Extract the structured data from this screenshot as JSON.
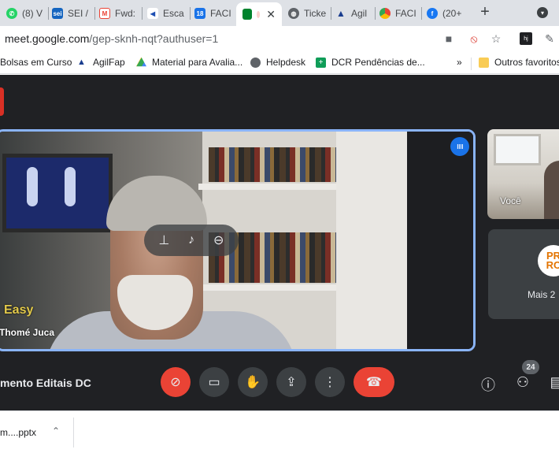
{
  "browser": {
    "tabs": [
      {
        "label": "(8) V",
        "icon": "whatsapp-icon",
        "color": "#25d366"
      },
      {
        "label": "SEI /",
        "icon": "sei-icon",
        "color": "#1565c0"
      },
      {
        "label": "Fwd:",
        "icon": "gmail-icon",
        "color": "#ea4335"
      },
      {
        "label": "Esca",
        "icon": "carrefour-icon",
        "color": "#1e4fb3"
      },
      {
        "label": "FACI",
        "icon": "calendar-icon",
        "color": "#1a73e8"
      },
      {
        "label": "",
        "icon": "meet-icon",
        "color": "#00832d",
        "active": true
      },
      {
        "label": "Ticke",
        "icon": "globe-icon",
        "color": "#5f6368"
      },
      {
        "label": "Agil",
        "icon": "agil-icon",
        "color": "#1a3d8f"
      },
      {
        "label": "FACI",
        "icon": "chrome-icon",
        "color": "#4285f4"
      },
      {
        "label": "(20+",
        "icon": "facebook-icon",
        "color": "#1877f2"
      }
    ],
    "new_tab": "+",
    "url_domain": "meet.google.com",
    "url_path": "/gep-sknh-nqt?authuser=1",
    "bookmarks": [
      {
        "label": "Bolsas em Curso"
      },
      {
        "label": "AgilFap"
      },
      {
        "label": "Material para Avalia..."
      },
      {
        "label": "Helpdesk"
      },
      {
        "label": "DCR Pendências de..."
      }
    ],
    "bookmarks_overflow": "»",
    "other_bookmarks": "Outros favoritos"
  },
  "meet": {
    "speaker_name": "Thomé Juca",
    "overlay_text": "Easy",
    "self_label": "Você",
    "more_label": "Mais 2",
    "more_avatar_line1": "PR",
    "more_avatar_line2": "RC",
    "meeting_title": "mento Editais DC",
    "participant_count": "24"
  },
  "downloads": {
    "file_name": "m....pptx"
  }
}
